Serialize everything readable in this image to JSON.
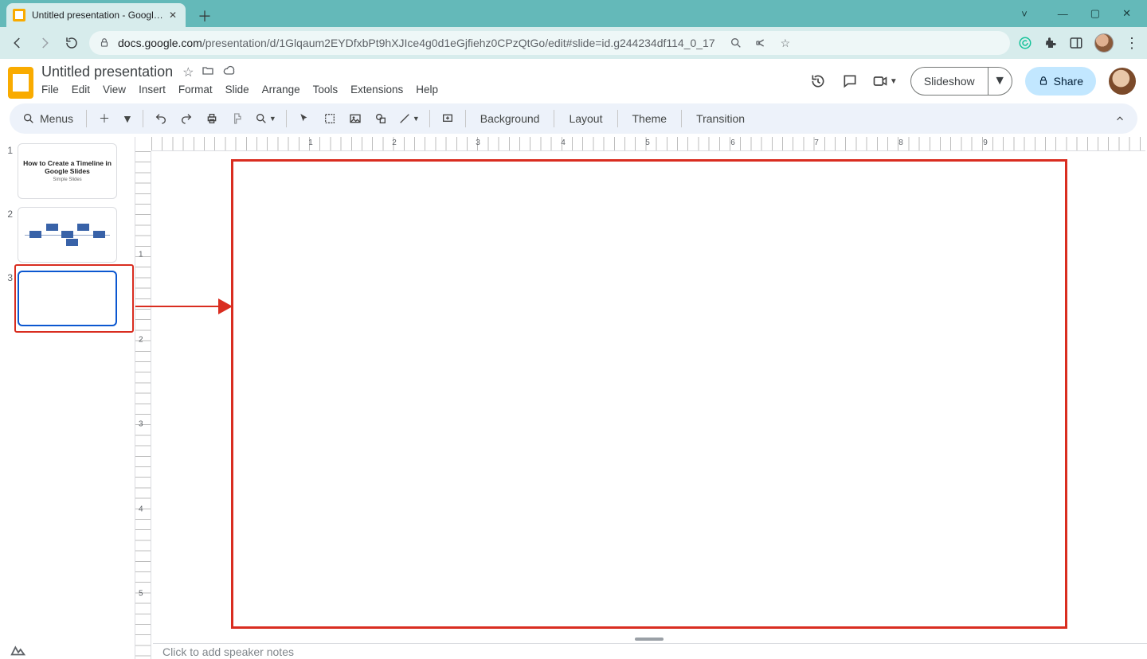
{
  "browser": {
    "tab_title": "Untitled presentation - Google Sl",
    "url_host": "docs.google.com",
    "url_path": "/presentation/d/1Glqaum2EYDfxbPt9hXJIce4g0d1eGjfiehz0CPzQtGo/edit#slide=id.g244234df114_0_17"
  },
  "doc": {
    "title": "Untitled presentation",
    "menus": [
      "File",
      "Edit",
      "View",
      "Insert",
      "Format",
      "Slide",
      "Arrange",
      "Tools",
      "Extensions",
      "Help"
    ],
    "slideshow_label": "Slideshow",
    "share_label": "Share"
  },
  "toolbar": {
    "menus_label": "Menus",
    "background_label": "Background",
    "layout_label": "Layout",
    "theme_label": "Theme",
    "transition_label": "Transition"
  },
  "slides": {
    "s1_num": "1",
    "s1_title": "How to Create a Timeline in Google Slides",
    "s1_sub": "Simple Slides",
    "s2_num": "2",
    "s3_num": "3",
    "selected_index": 3
  },
  "ruler_h": {
    "n1": "1",
    "n2": "2",
    "n3": "3",
    "n4": "4",
    "n5": "5",
    "n6": "6",
    "n7": "7",
    "n8": "8",
    "n9": "9"
  },
  "ruler_v": {
    "n1": "1",
    "n2": "2",
    "n3": "3",
    "n4": "4",
    "n5": "5"
  },
  "notes": {
    "placeholder": "Click to add speaker notes"
  }
}
